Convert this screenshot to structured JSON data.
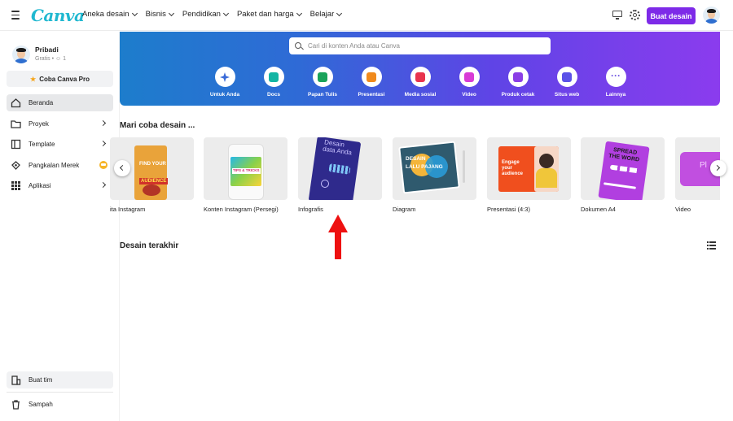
{
  "header": {
    "logo": "Canva",
    "nav": [
      "Aneka desain",
      "Bisnis",
      "Pendidikan",
      "Paket dan harga",
      "Belajar"
    ],
    "create_button": "Buat desain",
    "icons": [
      "menu-icon",
      "monitor-icon",
      "gear-icon"
    ]
  },
  "sidebar": {
    "user": {
      "name": "Pribadi",
      "plan": "Gratis",
      "members": "1"
    },
    "pro_button": "Coba Canva Pro",
    "items": [
      {
        "label": "Beranda",
        "icon": "home-icon",
        "active": true
      },
      {
        "label": "Proyek",
        "icon": "folder-icon"
      },
      {
        "label": "Template",
        "icon": "template-icon"
      },
      {
        "label": "Pangkalan Merek",
        "icon": "brand-icon"
      },
      {
        "label": "Aplikasi",
        "icon": "apps-grid-icon"
      }
    ],
    "bottom": [
      {
        "label": "Buat tim",
        "icon": "building-icon"
      },
      {
        "label": "Sampah",
        "icon": "trash-icon"
      }
    ]
  },
  "hero": {
    "search_placeholder": "Cari di konten Anda atau Canva",
    "categories": [
      {
        "label": "Untuk Anda",
        "color": "#3a6ad8",
        "icon": "sparkle-icon",
        "active": true
      },
      {
        "label": "Docs",
        "color": "#13b5a4",
        "icon": "docs-icon"
      },
      {
        "label": "Papan Tulis",
        "color": "#1aa35a",
        "icon": "whiteboard-icon"
      },
      {
        "label": "Presentasi",
        "color": "#f08a1c",
        "icon": "presentation-icon"
      },
      {
        "label": "Media sosial",
        "color": "#e8344e",
        "icon": "heart-icon"
      },
      {
        "label": "Video",
        "color": "#d83bd6",
        "icon": "video-icon"
      },
      {
        "label": "Produk cetak",
        "color": "#8b3ee6",
        "icon": "print-icon"
      },
      {
        "label": "Situs web",
        "color": "#5b52e8",
        "icon": "website-icon"
      },
      {
        "label": "Lainnya",
        "color": "#6b50e0",
        "icon": "more-icon"
      }
    ]
  },
  "try_section": {
    "title": "Mari coba desain ...",
    "cards": [
      {
        "label": "ita Instagram",
        "art_text": [
          "FIND YOUR",
          "AUDIENCE"
        ]
      },
      {
        "label": "Konten Instagram (Persegi)",
        "art_text": [
          "TIPS & TRICKS"
        ]
      },
      {
        "label": "Infografis",
        "art_text": [
          "Desain",
          "data Anda"
        ]
      },
      {
        "label": "Diagram",
        "art_text": [
          "DESAIN",
          "LALU PAJANG"
        ]
      },
      {
        "label": "Presentasi (4:3)",
        "art_text": [
          "Engage",
          "your",
          "audience"
        ]
      },
      {
        "label": "Dokumen A4",
        "art_text": [
          "SPREAD",
          "THE WORD"
        ]
      },
      {
        "label": "Video",
        "art_text": [
          "Pl"
        ]
      }
    ]
  },
  "recent_section": {
    "title": "Desain terakhir"
  }
}
